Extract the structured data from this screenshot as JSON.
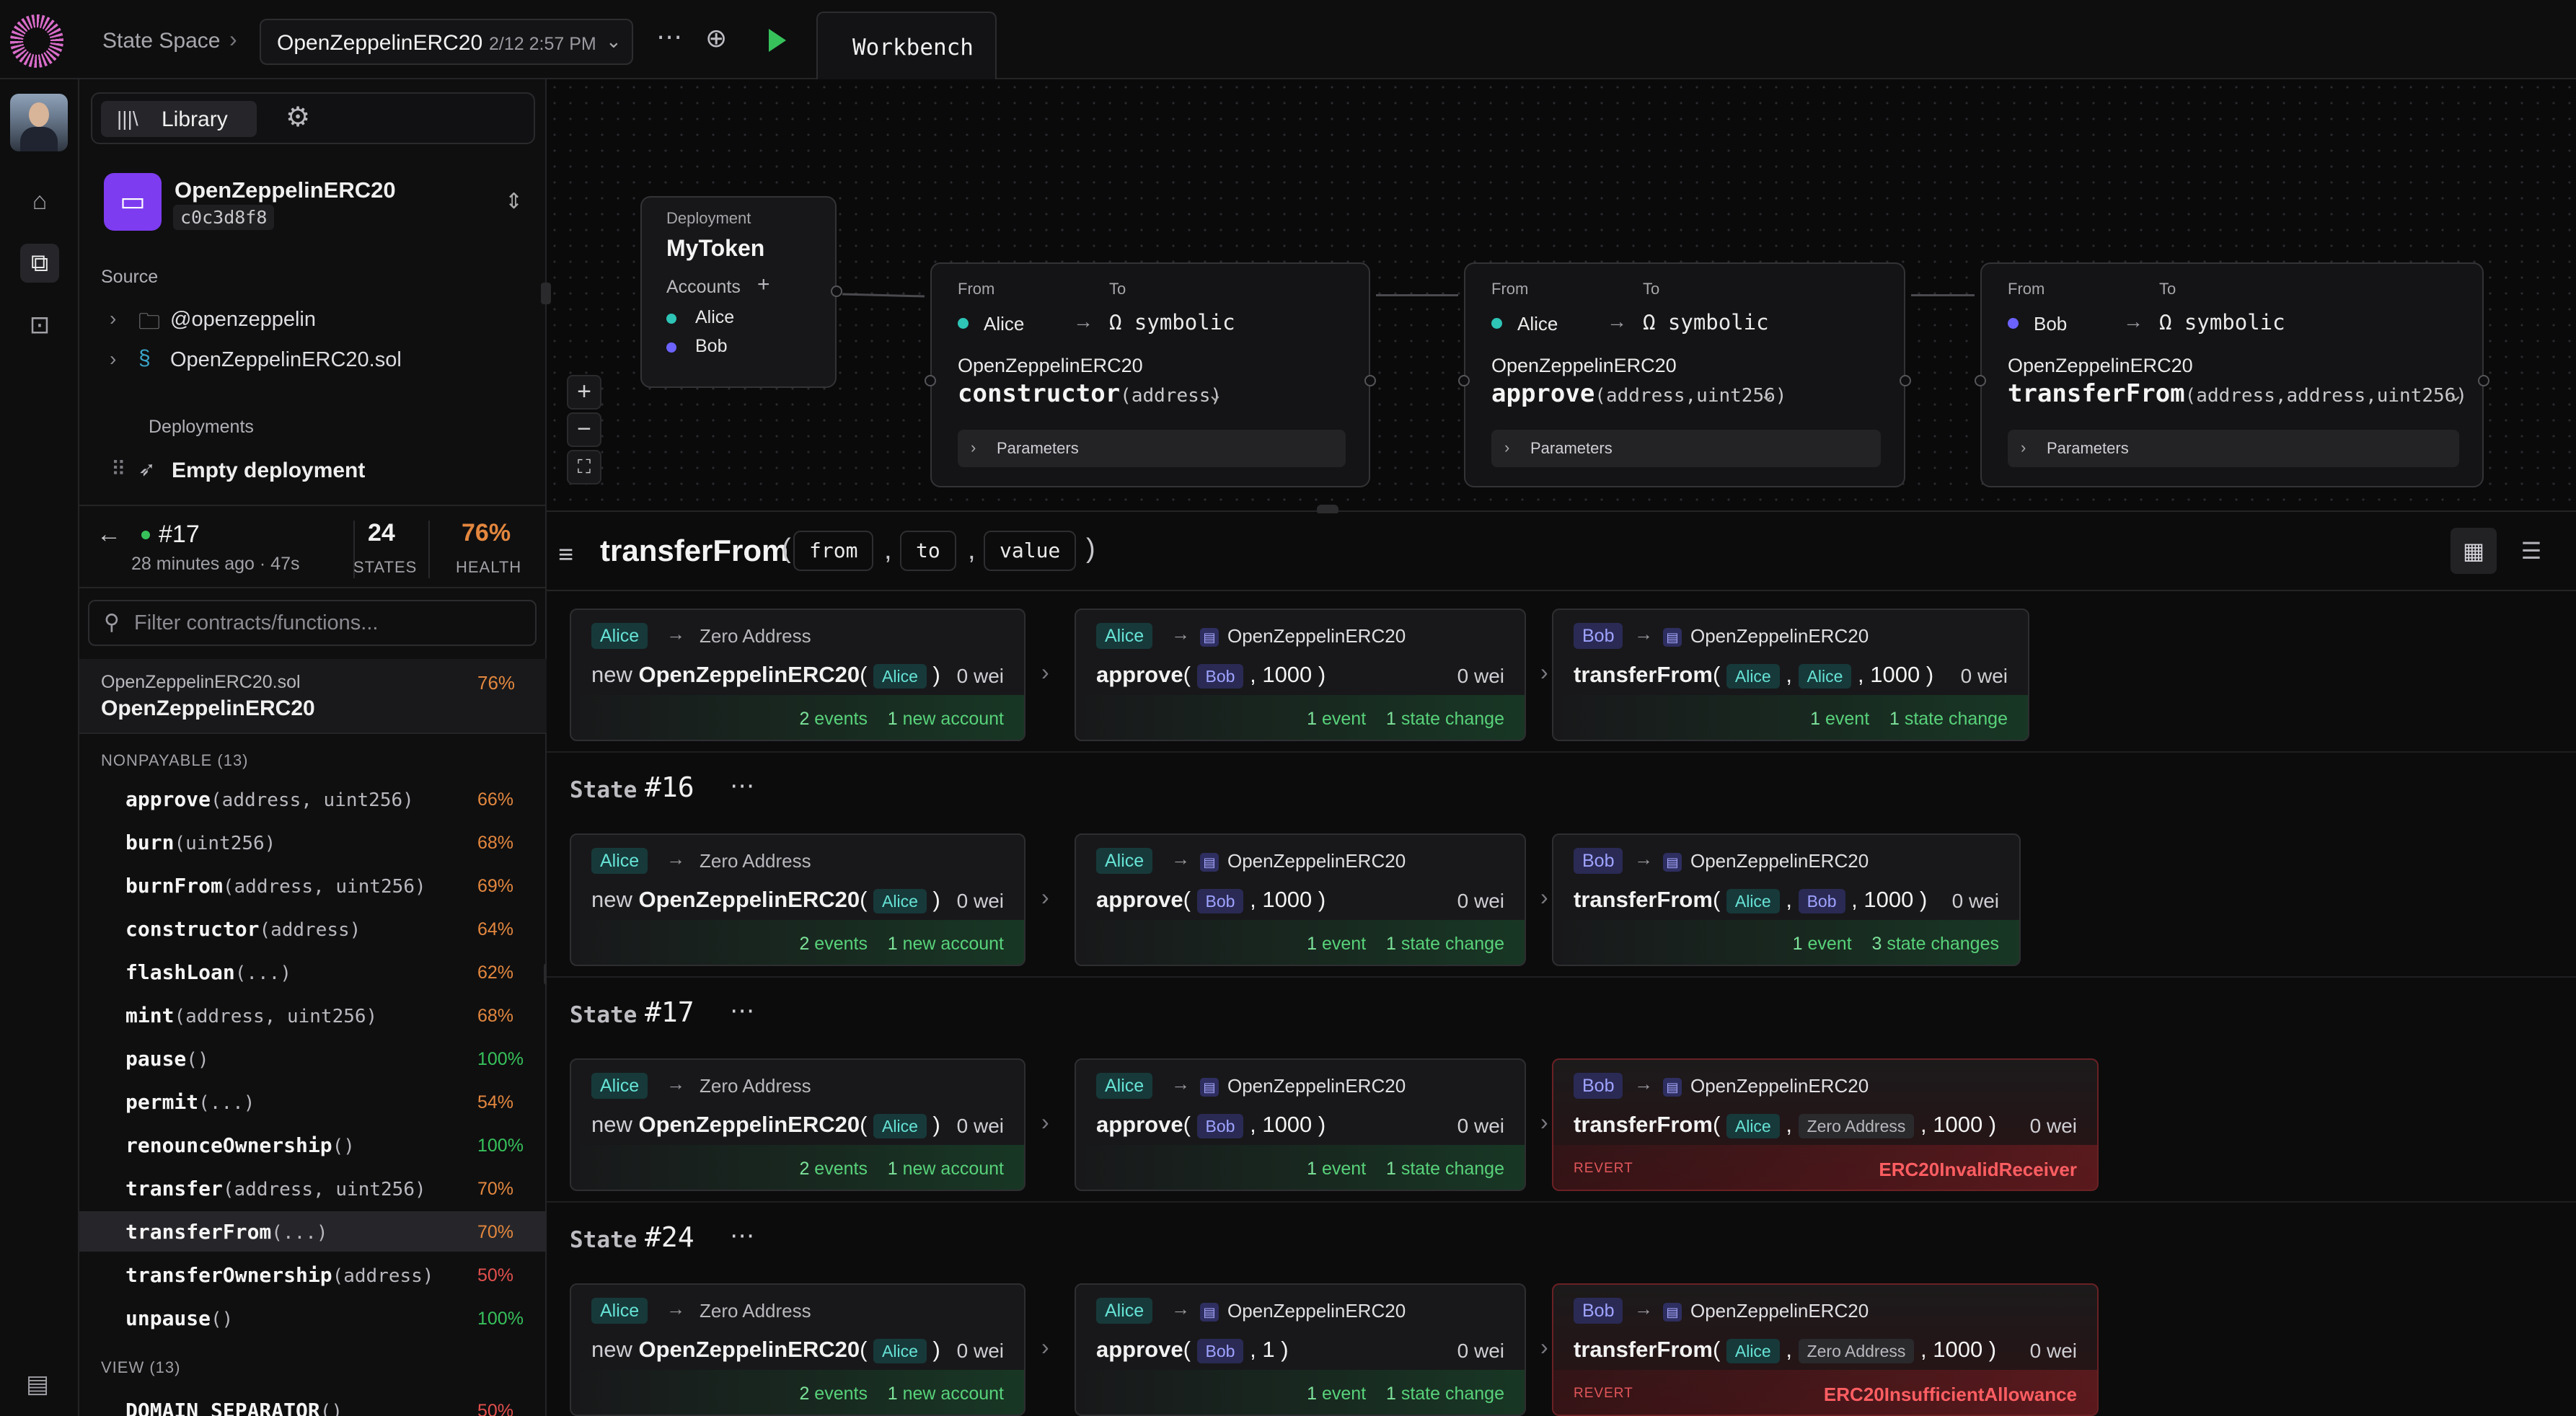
{
  "topbar": {
    "crumb": "State Space",
    "project": {
      "name": "OpenZeppelinERC20",
      "date": "2/12 2:57 PM"
    },
    "tab": "Workbench",
    "icons": [
      "more-horizontal-icon",
      "add-circle-icon",
      "play-icon"
    ]
  },
  "sidebar": {
    "library_label": "Library",
    "contract": {
      "name": "OpenZeppelinERC20",
      "hash": "c0c3d8f8"
    },
    "source_label": "Source",
    "source_items": [
      {
        "label": "@openzeppelin",
        "icon": "folder-icon"
      },
      {
        "label": "OpenZeppelinERC20.sol",
        "icon": "solidity-file-icon"
      }
    ],
    "deployments_label": "Deployments",
    "deployment_item": "Empty deployment",
    "run": {
      "id": "#17",
      "time": "28 minutes ago · 47s",
      "states_value": "24",
      "states_label": "STATES",
      "health_value": "76%",
      "health_label": "HEALTH"
    },
    "filter_placeholder": "Filter contracts/functions...",
    "file": {
      "name": "OpenZeppelinERC20.sol",
      "contract": "OpenZeppelinERC20",
      "pct": "76%"
    },
    "nonpayable_header": "NONPAYABLE (13)",
    "functions": [
      {
        "name": "approve",
        "args": "(address, uint256)",
        "pct": "66%",
        "color": "orange"
      },
      {
        "name": "burn",
        "args": "(uint256)",
        "pct": "68%",
        "color": "orange"
      },
      {
        "name": "burnFrom",
        "args": "(address, uint256)",
        "pct": "69%",
        "color": "orange"
      },
      {
        "name": "constructor",
        "args": "(address)",
        "pct": "64%",
        "color": "orange"
      },
      {
        "name": "flashLoan",
        "args": "(...)",
        "pct": "62%",
        "color": "orange"
      },
      {
        "name": "mint",
        "args": "(address, uint256)",
        "pct": "68%",
        "color": "orange"
      },
      {
        "name": "pause",
        "args": "()",
        "pct": "100%",
        "color": "green"
      },
      {
        "name": "permit",
        "args": "(...)",
        "pct": "54%",
        "color": "orange"
      },
      {
        "name": "renounceOwnership",
        "args": "()",
        "pct": "100%",
        "color": "green"
      },
      {
        "name": "transfer",
        "args": "(address, uint256)",
        "pct": "70%",
        "color": "orange"
      },
      {
        "name": "transferFrom",
        "args": "(...)",
        "pct": "70%",
        "color": "orange",
        "active": true
      },
      {
        "name": "transferOwnership",
        "args": "(address)",
        "pct": "50%",
        "color": "red"
      },
      {
        "name": "unpause",
        "args": "()",
        "pct": "100%",
        "color": "green"
      }
    ],
    "view_header": "VIEW (13)",
    "view_first": {
      "name": "DOMAIN_SEPARATOR",
      "args": "()",
      "pct": "50%"
    }
  },
  "canvas": {
    "deployment": {
      "label": "Deployment",
      "name": "MyToken",
      "accounts_label": "Accounts",
      "accounts": [
        "Alice",
        "Bob"
      ]
    },
    "nodes": [
      {
        "from_label": "From",
        "to_label": "To",
        "from": "Alice",
        "to": "symbolic",
        "contract": "OpenZeppelinERC20",
        "fn": "constructor",
        "args": "(address)",
        "params": "Parameters"
      },
      {
        "from_label": "From",
        "to_label": "To",
        "from": "Alice",
        "to": "symbolic",
        "contract": "OpenZeppelinERC20",
        "fn": "approve",
        "args": "(address,uint256)",
        "params": "Parameters"
      },
      {
        "from_label": "From",
        "to_label": "To",
        "from": "Bob",
        "to": "symbolic",
        "contract": "OpenZeppelinERC20",
        "fn": "transferFrom",
        "args": "(address,address,uint256)",
        "params": "Parameters"
      }
    ]
  },
  "results": {
    "fn": "transferFrom",
    "open_paren": "(",
    "close_paren": ")",
    "comma": ",",
    "args": [
      "from",
      "to",
      "value"
    ],
    "state_label": "State",
    "states": [
      {
        "name": "",
        "txs": [
          {
            "from": "Alice",
            "to": "Zero Address",
            "call": "OpenZeppelinERC20",
            "prefix": "new",
            "args": [
              "Alice"
            ],
            "wei": "0 wei",
            "ev1n": "2",
            "ev1": "events",
            "ev2n": "1",
            "ev2": "new account"
          },
          {
            "from": "Alice",
            "to": "OpenZeppelinERC20",
            "call": "approve",
            "args": [
              "Bob",
              "1000"
            ],
            "wei": "0 wei",
            "ev1n": "1",
            "ev1": "event",
            "ev2n": "1",
            "ev2": "state change"
          },
          {
            "from": "Bob",
            "to": "OpenZeppelinERC20",
            "call": "transferFrom",
            "args": [
              "Alice",
              "Alice",
              "1000"
            ],
            "wei": "0 wei",
            "ev1n": "1",
            "ev1": "event",
            "ev2n": "1",
            "ev2": "state change"
          }
        ]
      },
      {
        "name": "#16",
        "txs": [
          {
            "from": "Alice",
            "to": "Zero Address",
            "call": "OpenZeppelinERC20",
            "prefix": "new",
            "args": [
              "Alice"
            ],
            "wei": "0 wei",
            "ev1n": "2",
            "ev1": "events",
            "ev2n": "1",
            "ev2": "new account"
          },
          {
            "from": "Alice",
            "to": "OpenZeppelinERC20",
            "call": "approve",
            "args": [
              "Bob",
              "1000"
            ],
            "wei": "0 wei",
            "ev1n": "1",
            "ev1": "event",
            "ev2n": "1",
            "ev2": "state change"
          },
          {
            "from": "Bob",
            "to": "OpenZeppelinERC20",
            "call": "transferFrom",
            "args": [
              "Alice",
              "Bob",
              "1000"
            ],
            "wei": "0 wei",
            "ev1n": "1",
            "ev1": "event",
            "ev2n": "3",
            "ev2": "state changes"
          }
        ]
      },
      {
        "name": "#17",
        "txs": [
          {
            "from": "Alice",
            "to": "Zero Address",
            "call": "OpenZeppelinERC20",
            "prefix": "new",
            "args": [
              "Alice"
            ],
            "wei": "0 wei",
            "ev1n": "2",
            "ev1": "events",
            "ev2n": "1",
            "ev2": "new account"
          },
          {
            "from": "Alice",
            "to": "OpenZeppelinERC20",
            "call": "approve",
            "args": [
              "Bob",
              "1000"
            ],
            "wei": "0 wei",
            "ev1n": "1",
            "ev1": "event",
            "ev2n": "1",
            "ev2": "state change"
          },
          {
            "from": "Bob",
            "to": "OpenZeppelinERC20",
            "call": "transferFrom",
            "args": [
              "Alice",
              "Zero Address",
              "1000"
            ],
            "wei": "0 wei",
            "revert": "REVERT",
            "error": "ERC20InvalidReceiver"
          }
        ]
      },
      {
        "name": "#24",
        "txs": [
          {
            "from": "Alice",
            "to": "Zero Address",
            "call": "OpenZeppelinERC20",
            "prefix": "new",
            "args": [
              "Alice"
            ],
            "wei": "0 wei",
            "ev1n": "2",
            "ev1": "events",
            "ev2n": "1",
            "ev2": "new account"
          },
          {
            "from": "Alice",
            "to": "OpenZeppelinERC20",
            "call": "approve",
            "args": [
              "Bob",
              "1"
            ],
            "wei": "0 wei",
            "ev1n": "1",
            "ev1": "event",
            "ev2n": "1",
            "ev2": "state change"
          },
          {
            "from": "Bob",
            "to": "OpenZeppelinERC20",
            "call": "transferFrom",
            "args": [
              "Alice",
              "Zero Address",
              "1000"
            ],
            "wei": "0 wei",
            "revert": "REVERT",
            "error": "ERC20InsufficientAllowance"
          }
        ]
      }
    ]
  },
  "colors": {
    "accent": "#7d3cf0",
    "green": "#37c15b",
    "orange": "#e3873e",
    "red": "#e2504d",
    "alice": "#2ec4b6",
    "bob": "#6c63ff"
  }
}
